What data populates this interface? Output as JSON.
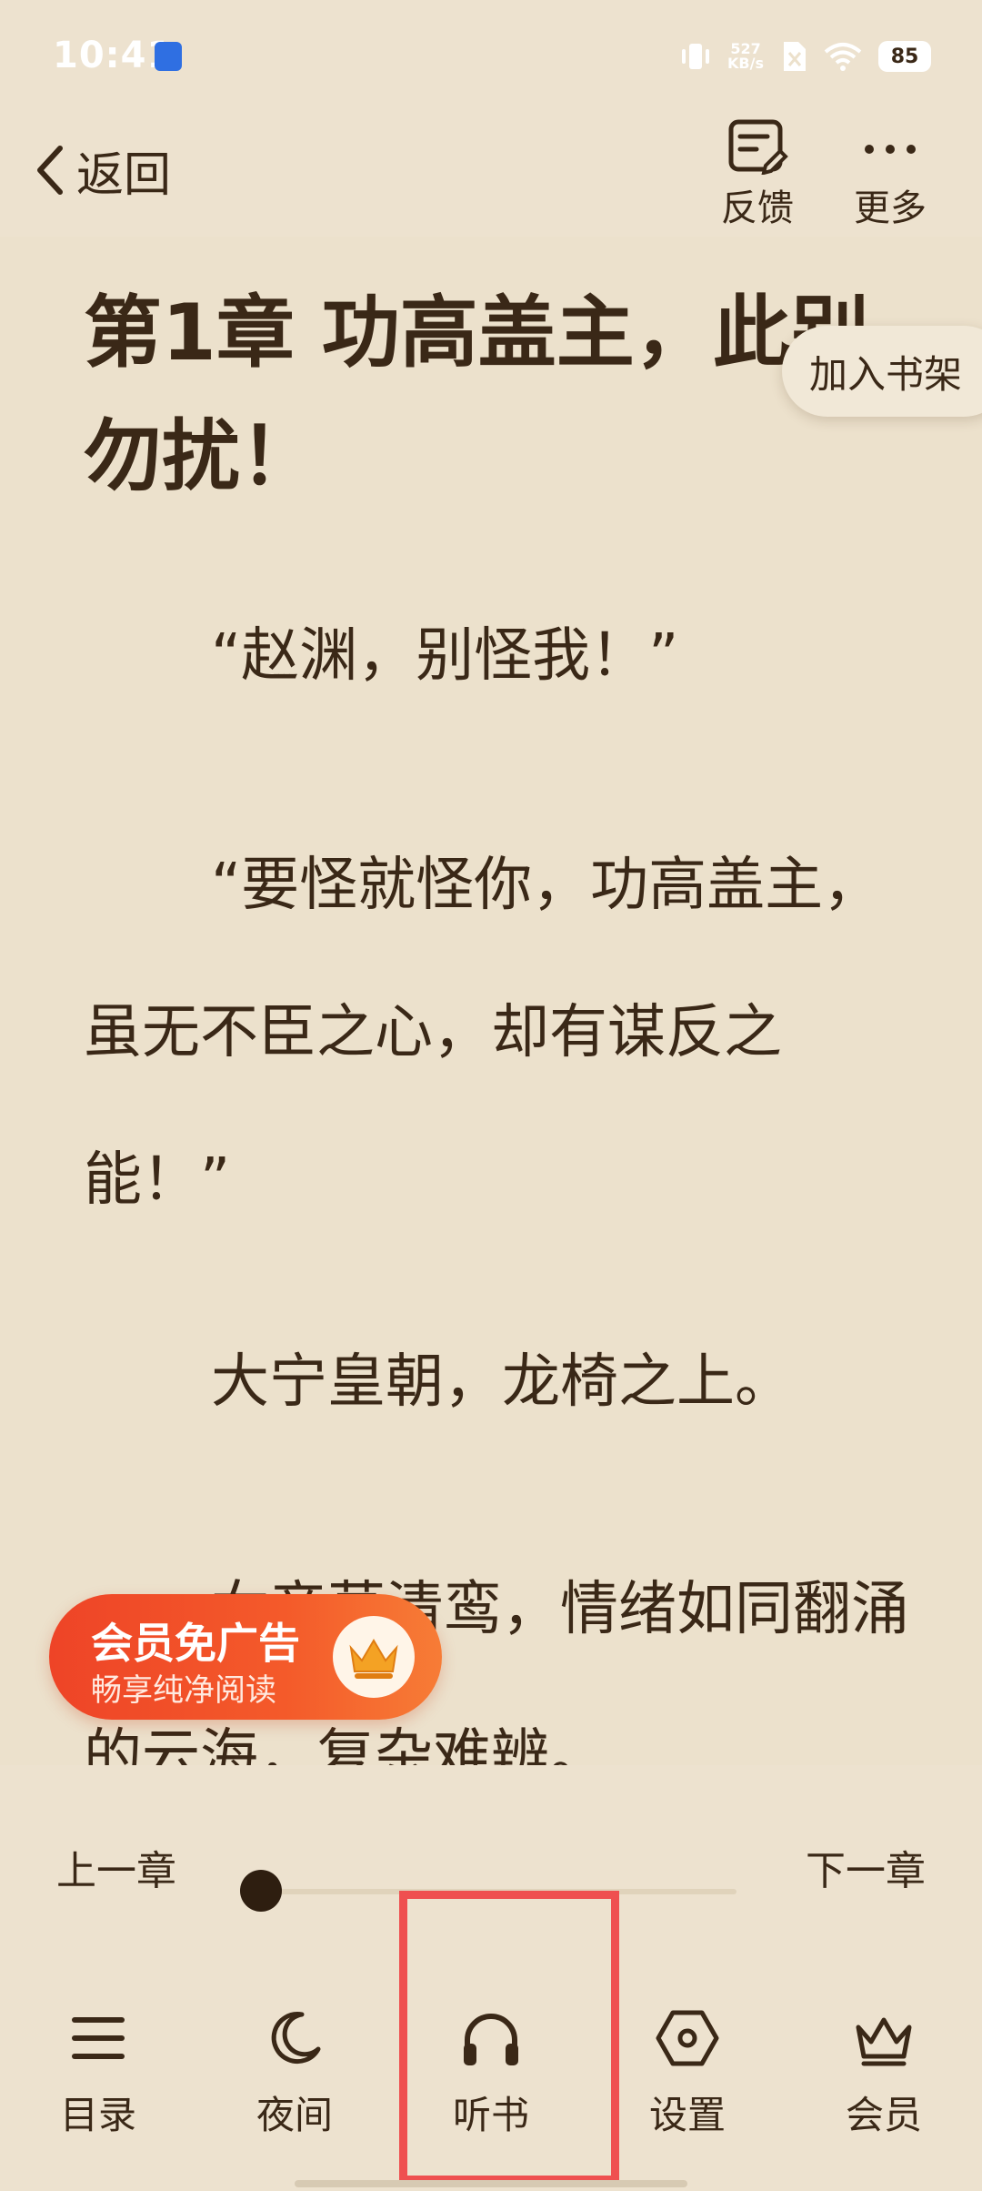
{
  "status_bar": {
    "time": "10:41",
    "net_speed_value": "527",
    "net_speed_unit": "KB/s",
    "battery": "85",
    "icons": [
      "app-notification-icon",
      "vibrate-icon",
      "sim-disabled-icon",
      "wifi-icon",
      "battery-icon"
    ]
  },
  "nav": {
    "back_label": "返回",
    "feedback_label": "反馈",
    "more_label": "更多"
  },
  "reader": {
    "chapter_title": "第1章 功高盖主，此别勿扰！",
    "paragraphs": [
      "“赵渊，别怪我！”",
      "“要怪就怪你，功高盖主，虽无不臣之心，却有谋反之能！”",
      "大宁皇朝，龙椅之上。",
      "女帝莫清鸾，情绪如同翻涌的云海，复杂难辨。"
    ],
    "add_to_shelf": "加入书架"
  },
  "vip_banner": {
    "title": "会员免广告",
    "subtitle": "畅享纯净阅读"
  },
  "chapter_nav": {
    "prev": "上一章",
    "next": "下一章",
    "progress": 0
  },
  "toolbar": {
    "items": [
      {
        "label": "目录",
        "icon": "menu-list-icon"
      },
      {
        "label": "夜间",
        "icon": "moon-icon"
      },
      {
        "label": "听书",
        "icon": "headphones-icon"
      },
      {
        "label": "设置",
        "icon": "settings-hex-icon"
      },
      {
        "label": "会员",
        "icon": "crown-icon"
      }
    ]
  },
  "colors": {
    "background": "#ece1cc",
    "text": "#3a2817",
    "highlight": "#ef5050",
    "vip_gradient_start": "#ee4427",
    "vip_gradient_end": "#f77c36"
  }
}
